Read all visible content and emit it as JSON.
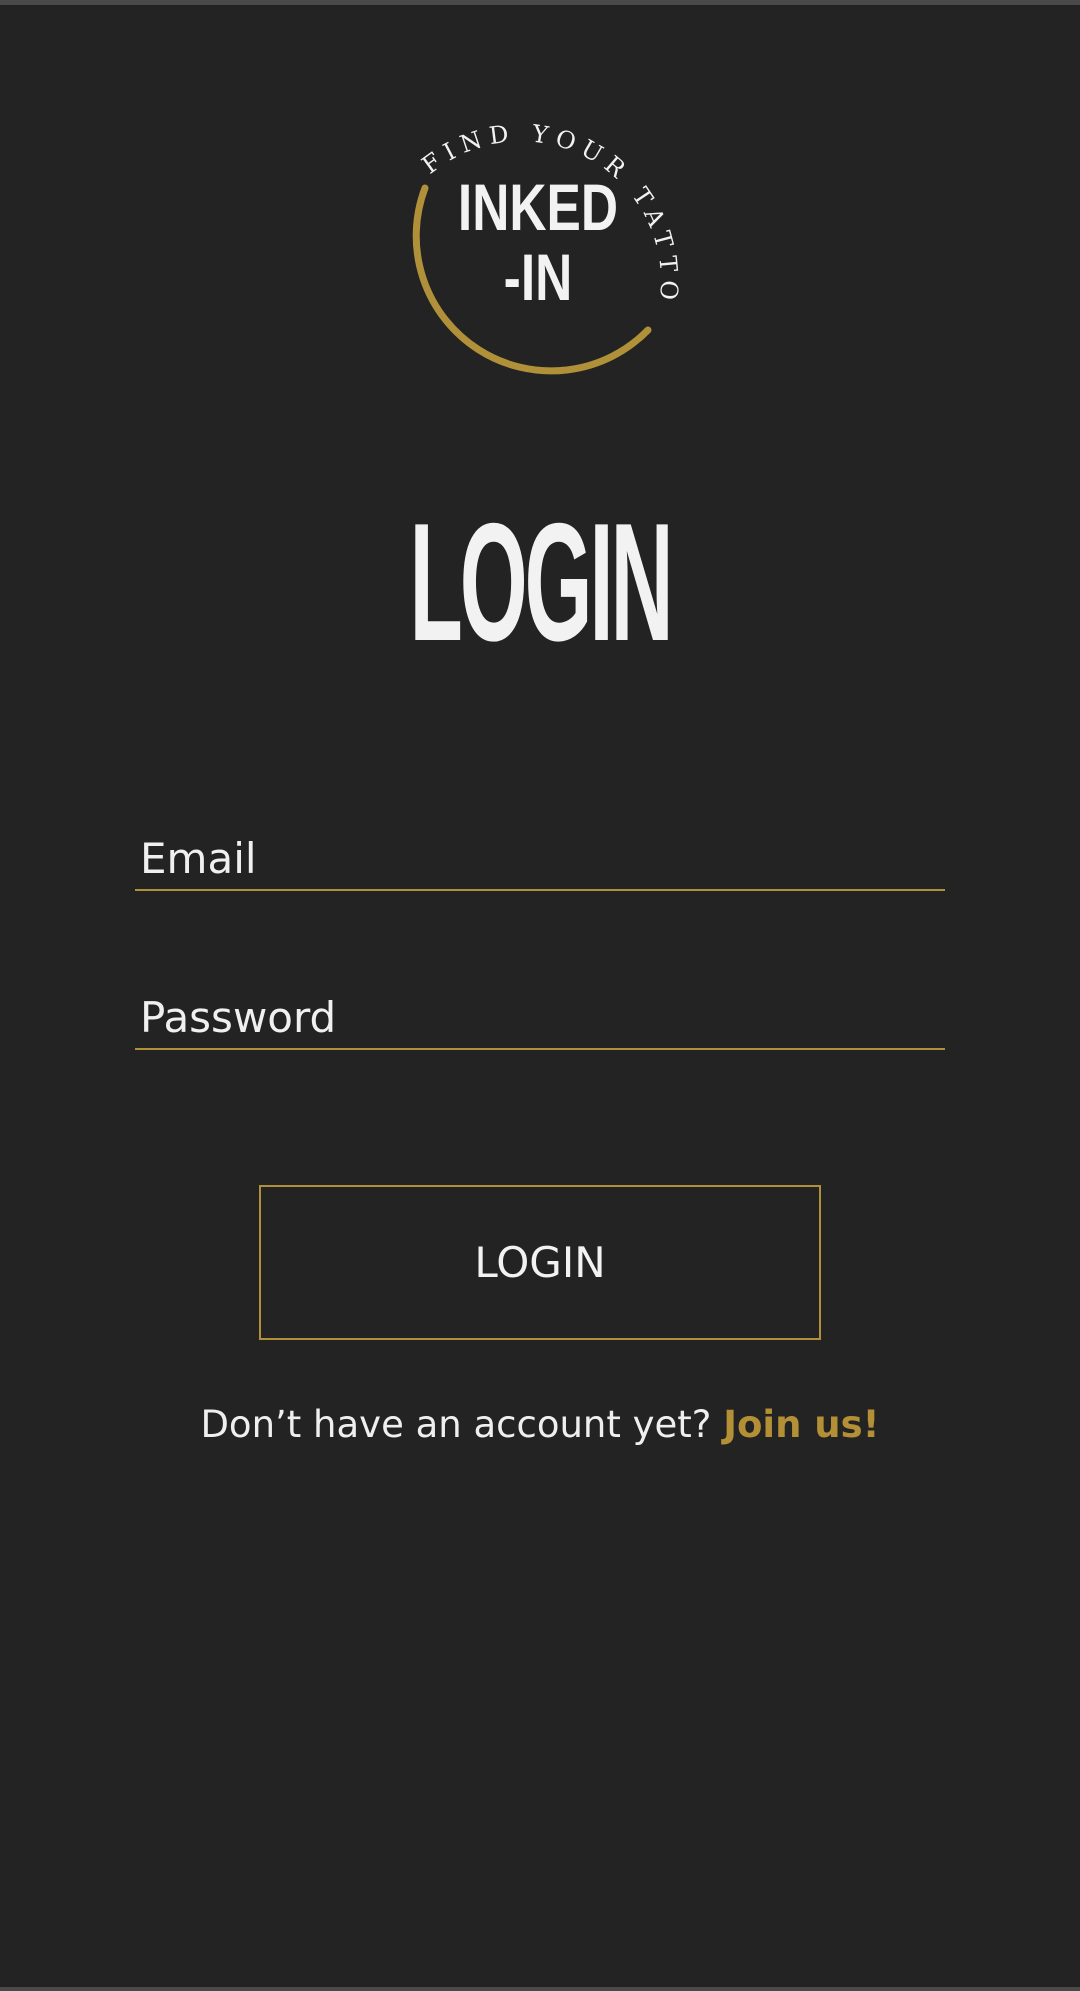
{
  "logo": {
    "arc_text": "FIND YOUR TATTOOER",
    "line1": "INKED",
    "line2": "-IN"
  },
  "page_title": "LOGIN",
  "form": {
    "email_placeholder": "Email",
    "password_placeholder": "Password",
    "submit_label": "LOGIN"
  },
  "signup": {
    "prompt": "Don’t have an account yet?",
    "link_label": "Join us!"
  },
  "colors": {
    "background": "#232323",
    "accent": "#b1903a",
    "text": "#f0f0f0"
  }
}
